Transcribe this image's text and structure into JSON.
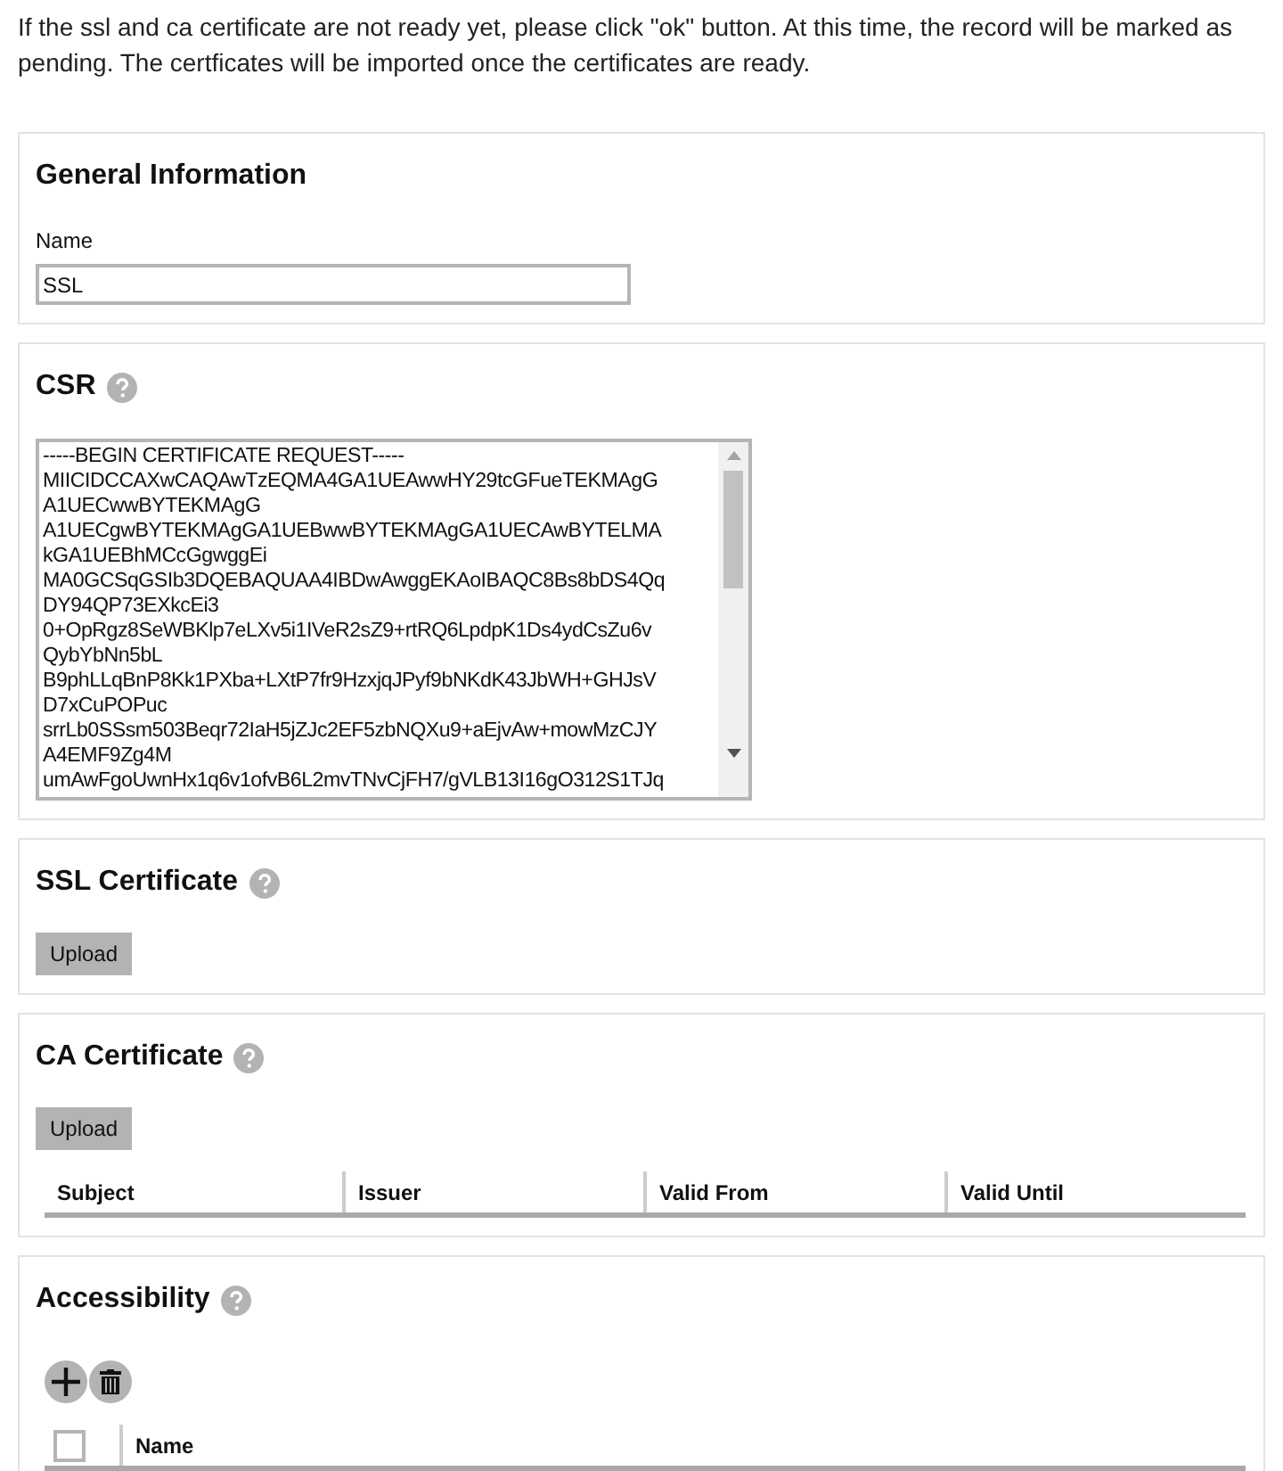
{
  "notice": "If the ssl and ca certificate are not ready yet, please click \"ok\" button. At this time, the record will be marked as pending. The certficates will be imported once the certificates are ready.",
  "sections": [
    {
      "kind": "form",
      "title": "General Information",
      "help": false,
      "field": {
        "label": "Name",
        "value": "SSL"
      }
    },
    {
      "kind": "csr",
      "title": "CSR",
      "help": true,
      "lines": [
        "-----BEGIN CERTIFICATE REQUEST-----",
        "MIICIDCCAXwCAQAwTzEQMA4GA1UEAwwHY29tcGFueTEKMAgG",
        "A1UECwwBYTEKMAgG",
        "A1UECgwBYTEKMAgGA1UEBwwBYTEKMAgGA1UECAwBYTELMA",
        "kGA1UEBhMCcGgwggEi",
        "MA0GCSqGSIb3DQEBAQUAA4IBDwAwggEKAoIBAQC8Bs8bDS4Qq",
        "DY94QP73EXkcEi3",
        "0+OpRgz8SeWBKlp7eLXv5i1IVeR2sZ9+rtRQ6LpdpK1Ds4ydCsZu6v",
        "QybYbNn5bL",
        "B9phLLqBnP8Kk1PXba+LXtP7fr9HzxjqJPyf9bNKdK43JbWH+GHJsV",
        "D7xCuPOPuc",
        "srrLb0SSsm503Beqr72IaH5jZJc2EF5zbNQXu9+aEjvAw+mowMzCJY",
        "A4EMF9Zg4M",
        "umAwFgoUwnHx1q6v1ofvB6L2mvTNvCjFH7/gVLB13I16gO312S1TJq"
      ]
    },
    {
      "kind": "upload",
      "title": "SSL Certificate",
      "help": true,
      "button": "Upload"
    },
    {
      "kind": "upload",
      "title": "CA Certificate",
      "help": true,
      "button": "Upload",
      "columns": [
        "Subject",
        "Issuer",
        "Valid From",
        "Valid Until"
      ]
    },
    {
      "kind": "list",
      "title": "Accessibility",
      "help": true,
      "select_all": {
        "checked": false
      },
      "columns": [
        "Name"
      ]
    }
  ]
}
